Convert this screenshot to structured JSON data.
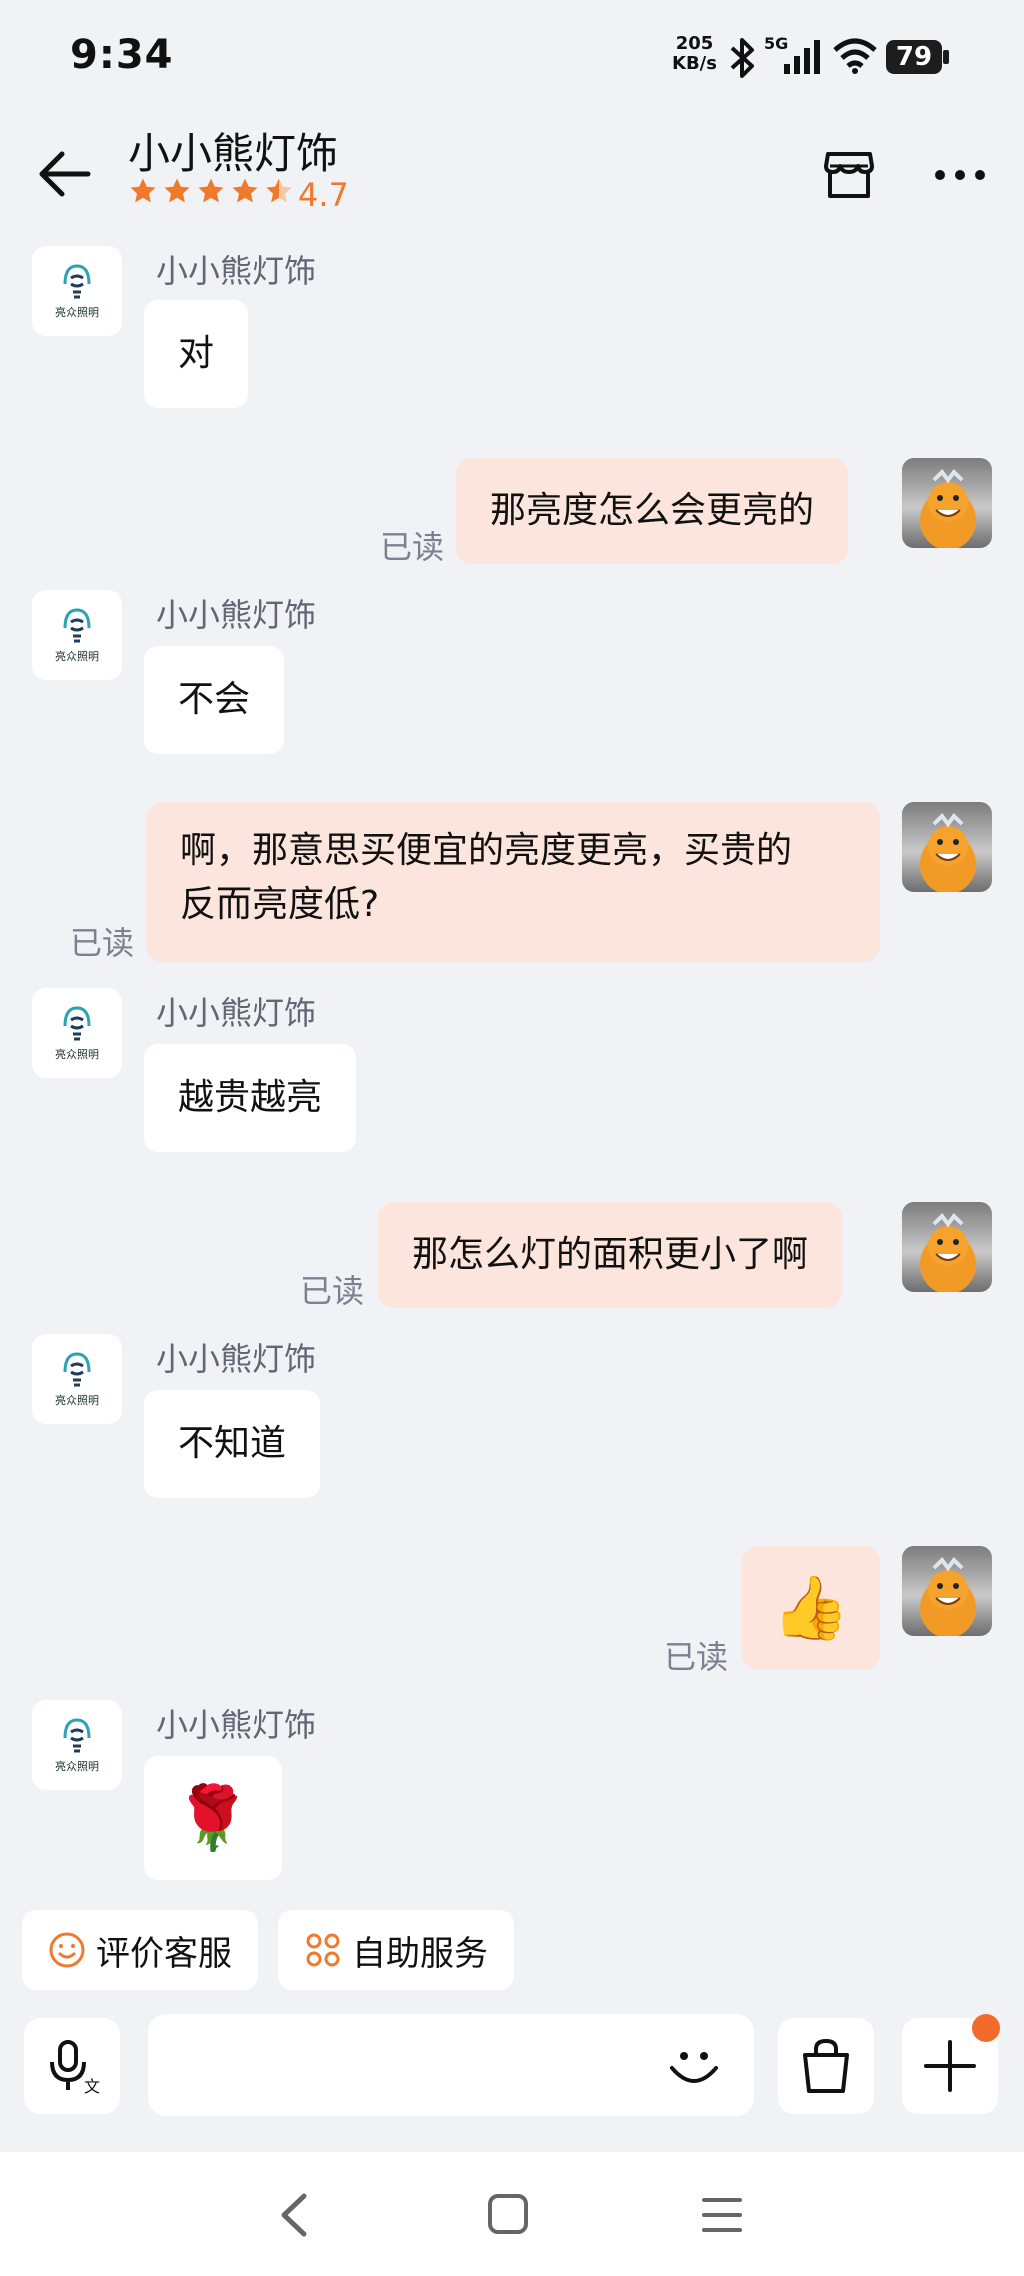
{
  "status_bar": {
    "time": "9:34",
    "net_speed_value": "205",
    "net_speed_unit": "KB/s",
    "network_type": "5G",
    "battery": "79",
    "icons": [
      "bluetooth-icon",
      "signal-icon",
      "wifi-icon",
      "battery-icon"
    ]
  },
  "header": {
    "title": "小小熊灯饰",
    "rating": "4.7",
    "stars": 4.5,
    "shop_logo_text": "亮众照明"
  },
  "messages": [
    {
      "from": "shop",
      "sender": "小小熊灯饰",
      "text": "对"
    },
    {
      "from": "user",
      "text": "那亮度怎么会更亮的",
      "status": "已读"
    },
    {
      "from": "shop",
      "sender": "小小熊灯饰",
      "text": "不会"
    },
    {
      "from": "user",
      "text_line1": "啊，那意思买便宜的亮度更亮，买贵的",
      "text_line2": "反而亮度低?",
      "status": "已读"
    },
    {
      "from": "shop",
      "sender": "小小熊灯饰",
      "text": "越贵越亮"
    },
    {
      "from": "user",
      "text": "那怎么灯的面积更小了啊",
      "status": "已读"
    },
    {
      "from": "shop",
      "sender": "小小熊灯饰",
      "text": "不知道"
    },
    {
      "from": "user",
      "emoji": "👍",
      "status": "已读"
    },
    {
      "from": "shop",
      "sender": "小小熊灯饰",
      "emoji": "🌹"
    }
  ],
  "quick_actions": [
    {
      "label": "评价客服",
      "icon": "smiley-icon"
    },
    {
      "label": "自助服务",
      "icon": "grid-icon"
    }
  ],
  "colors": {
    "accent": "#f07a2c",
    "outgoing_bubble": "#fbe5dc",
    "background": "#f1f2f5"
  }
}
